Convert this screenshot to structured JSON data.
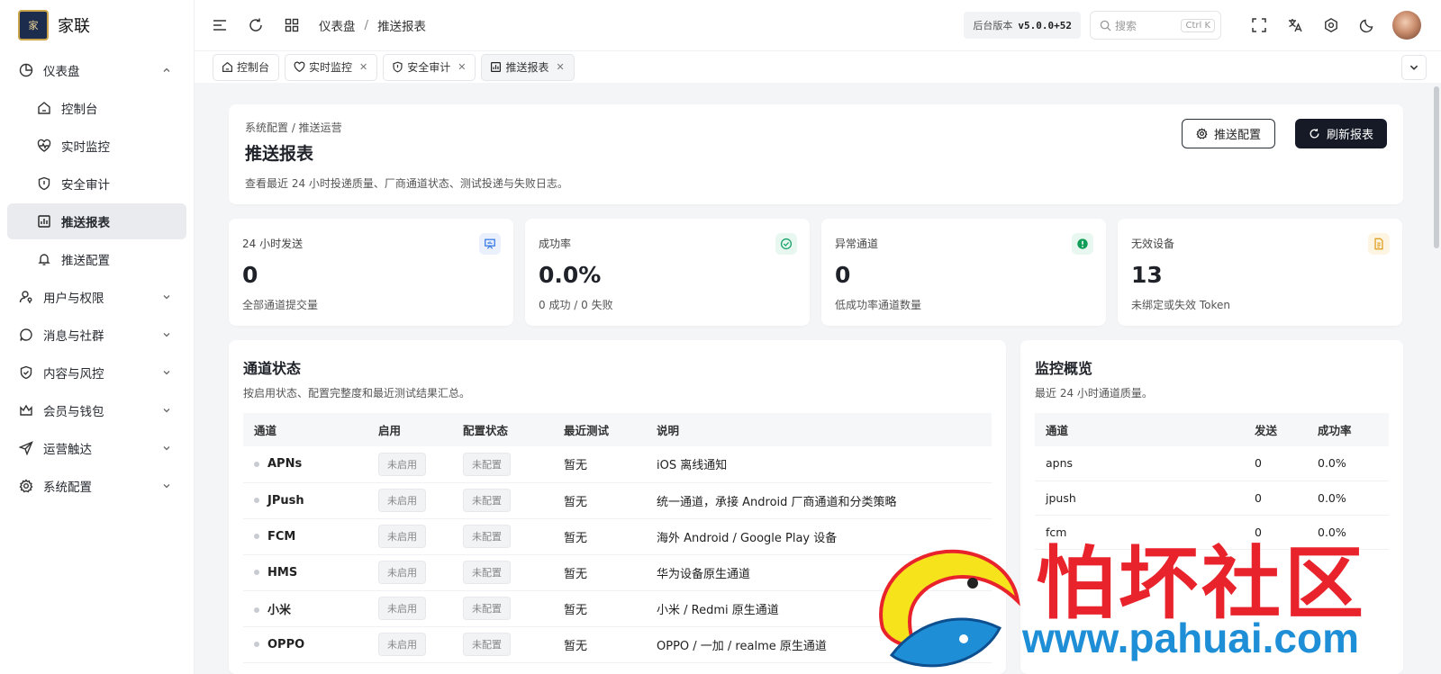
{
  "brand": {
    "name": "家联",
    "logo_text": "家"
  },
  "sidebar": {
    "items": [
      {
        "label": "仪表盘",
        "icon": "dashboard-icon",
        "expanded": true
      },
      {
        "label": "控制台",
        "icon": "home-icon",
        "sub": true
      },
      {
        "label": "实时监控",
        "icon": "heart-pulse-icon",
        "sub": true
      },
      {
        "label": "安全审计",
        "icon": "shield-icon",
        "sub": true
      },
      {
        "label": "推送报表",
        "icon": "bar-chart-icon",
        "sub": true,
        "active": true
      },
      {
        "label": "推送配置",
        "icon": "bell-icon",
        "sub": true
      },
      {
        "label": "用户与权限",
        "icon": "user-key-icon"
      },
      {
        "label": "消息与社群",
        "icon": "chat-icon"
      },
      {
        "label": "内容与风控",
        "icon": "shield-check-icon"
      },
      {
        "label": "会员与钱包",
        "icon": "crown-icon"
      },
      {
        "label": "运营触达",
        "icon": "send-icon"
      },
      {
        "label": "系统配置",
        "icon": "gear-icon"
      }
    ]
  },
  "header": {
    "breadcrumb": [
      "仪表盘",
      "推送报表"
    ],
    "version_label": "后台版本",
    "version": "v5.0.0+52",
    "search_placeholder": "搜索",
    "search_kbd": "Ctrl K"
  },
  "tabs": [
    {
      "label": "控制台",
      "icon": "home-icon",
      "closable": false
    },
    {
      "label": "实时监控",
      "icon": "heart-pulse-icon",
      "closable": true
    },
    {
      "label": "安全审计",
      "icon": "shield-icon",
      "closable": true
    },
    {
      "label": "推送报表",
      "icon": "bar-chart-icon",
      "closable": true,
      "active": true
    }
  ],
  "page": {
    "breadcrumb": "系统配置 / 推送运营",
    "title": "推送报表",
    "description": "查看最近 24 小时投递质量、厂商通道状态、测试投递与失败日志。",
    "btn_config": "推送配置",
    "btn_refresh": "刷新报表"
  },
  "stats": [
    {
      "label": "24 小时发送",
      "value": "0",
      "sub": "全部通道提交量",
      "icon": "presentation-icon",
      "color": "#3b7be8",
      "bg": "#eaf1fd"
    },
    {
      "label": "成功率",
      "value": "0.0%",
      "sub": "0 成功 / 0 失败",
      "icon": "check-circle-icon",
      "color": "#1aa36b",
      "bg": "#e8f7ef"
    },
    {
      "label": "异常通道",
      "value": "0",
      "sub": "低成功率通道数量",
      "icon": "alert-icon",
      "color": "#0f9d58",
      "bg": "#e8f7ef"
    },
    {
      "label": "无效设备",
      "value": "13",
      "sub": "未绑定或失效 Token",
      "icon": "file-icon",
      "color": "#e0a124",
      "bg": "#fdf4e1"
    }
  ],
  "channels": {
    "title": "通道状态",
    "description": "按启用状态、配置完整度和最近测试结果汇总。",
    "columns": [
      "通道",
      "启用",
      "配置状态",
      "最近测试",
      "说明"
    ],
    "rows": [
      {
        "name": "APNs",
        "enabled": "未启用",
        "config": "未配置",
        "test": "暂无",
        "desc": "iOS 离线通知"
      },
      {
        "name": "JPush",
        "enabled": "未启用",
        "config": "未配置",
        "test": "暂无",
        "desc": "统一通道，承接 Android 厂商通道和分类策略"
      },
      {
        "name": "FCM",
        "enabled": "未启用",
        "config": "未配置",
        "test": "暂无",
        "desc": "海外 Android / Google Play 设备"
      },
      {
        "name": "HMS",
        "enabled": "未启用",
        "config": "未配置",
        "test": "暂无",
        "desc": "华为设备原生通道"
      },
      {
        "name": "小米",
        "enabled": "未启用",
        "config": "未配置",
        "test": "暂无",
        "desc": "小米 / Redmi 原生通道"
      },
      {
        "name": "OPPO",
        "enabled": "未启用",
        "config": "未配置",
        "test": "暂无",
        "desc": "OPPO / 一加 / realme 原生通道"
      }
    ]
  },
  "monitor": {
    "title": "监控概览",
    "description": "最近 24 小时通道质量。",
    "columns": [
      "通道",
      "发送",
      "成功率"
    ],
    "rows": [
      {
        "channel": "apns",
        "sent": "0",
        "rate": "0.0%"
      },
      {
        "channel": "jpush",
        "sent": "0",
        "rate": "0.0%"
      },
      {
        "channel": "fcm",
        "sent": "0",
        "rate": "0.0%"
      }
    ]
  },
  "watermark": {
    "text": "怕坏社区",
    "url": "www.pahuai.com"
  }
}
